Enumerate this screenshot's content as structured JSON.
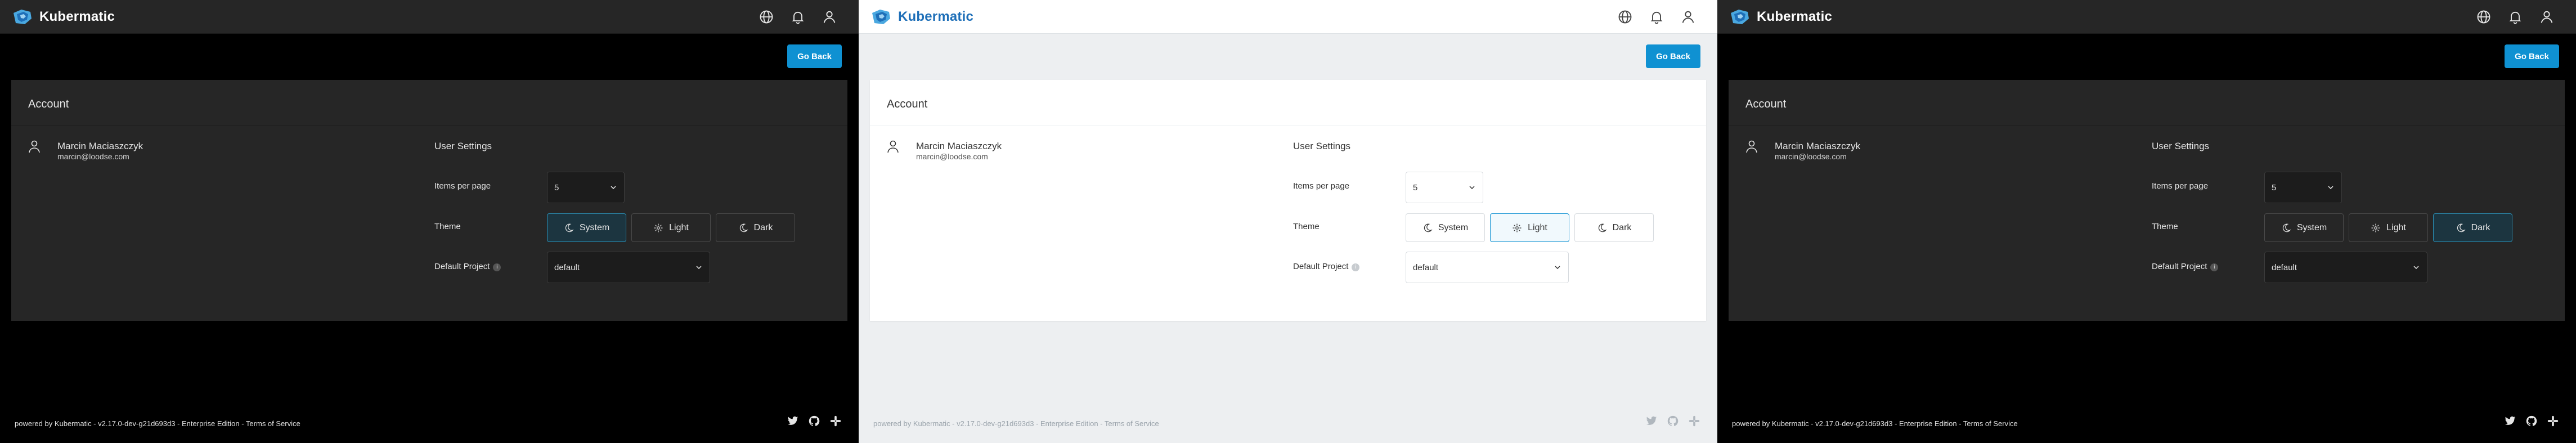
{
  "app": {
    "brand": "Kubermatic"
  },
  "header": {
    "icons": [
      "globe-icon",
      "bell-icon",
      "account-icon"
    ]
  },
  "toolbar": {
    "go_back_label": "Go Back"
  },
  "account": {
    "title": "Account",
    "user_name": "Marcin Maciaszczyk",
    "user_email": "marcin@loodse.com"
  },
  "settings": {
    "title": "User Settings",
    "items_per_page_label": "Items per page",
    "items_per_page_value": "5",
    "theme_label": "Theme",
    "theme_options": [
      {
        "label": "System",
        "icon": "moon-icon"
      },
      {
        "label": "Light",
        "icon": "sun-icon"
      },
      {
        "label": "Dark",
        "icon": "moon-icon"
      }
    ],
    "default_project_label": "Default Project",
    "default_project_value": "default",
    "info_icon_glyph": "i"
  },
  "footer": {
    "text": "powered by Kubermatic  -  v2.17.0-dev-g21d693d3  -  Enterprise Edition  -  Terms of Service",
    "icons": [
      "twitter-icon",
      "github-icon",
      "slack-icon"
    ]
  },
  "panels": [
    {
      "theme": "dark",
      "selected_theme": "System"
    },
    {
      "theme": "light",
      "selected_theme": "Light"
    },
    {
      "theme": "dark",
      "selected_theme": "Dark"
    }
  ],
  "colors": {
    "accent": "#0f91d2",
    "dark_bg": "#000000",
    "dark_surface": "#262626",
    "light_bg": "#edeff1",
    "light_surface": "#ffffff"
  }
}
